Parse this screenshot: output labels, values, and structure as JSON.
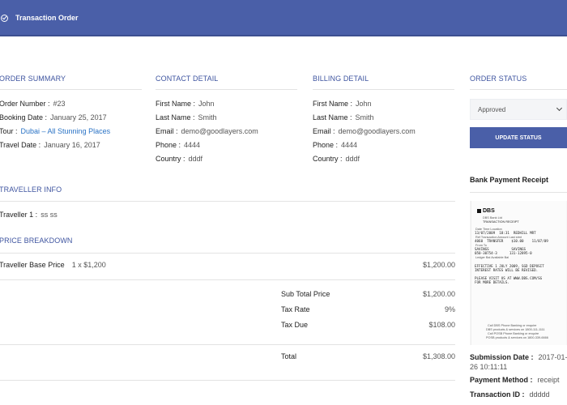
{
  "header": {
    "title": "Transaction Order"
  },
  "order_summary": {
    "title": "ORDER SUMMARY",
    "order_number_label": "Order Number :",
    "order_number": "#23",
    "booking_date_label": "Booking Date :",
    "booking_date": "January 25, 2017",
    "tour_label": "Tour :",
    "tour": "Dubai – All Stunning Places",
    "travel_date_label": "Travel Date :",
    "travel_date": "January 16, 2017"
  },
  "contact": {
    "title": "CONTACT DETAIL",
    "first_name_label": "First Name :",
    "first_name": "John",
    "last_name_label": "Last Name :",
    "last_name": "Smith",
    "email_label": "Email :",
    "email": "demo@goodlayers.com",
    "phone_label": "Phone :",
    "phone": "4444",
    "country_label": "Country :",
    "country": "dddf"
  },
  "billing": {
    "title": "BILLING DETAIL",
    "first_name_label": "First Name :",
    "first_name": "John",
    "last_name_label": "Last Name :",
    "last_name": "Smith",
    "email_label": "Email :",
    "email": "demo@goodlayers.com",
    "phone_label": "Phone :",
    "phone": "4444",
    "country_label": "Country :",
    "country": "dddf"
  },
  "order_status": {
    "title": "ORDER STATUS",
    "selected": "Approved",
    "button": "UPDATE STATUS"
  },
  "traveller": {
    "title": "TRAVELLER INFO",
    "label": "Traveller 1 :",
    "value": "ss ss"
  },
  "price": {
    "title": "PRICE BREAKDOWN",
    "base_label": "Traveller Base Price",
    "base_qty": "1 x $1,200",
    "base_amount": "$1,200.00",
    "subtotal_label": "Sub Total Price",
    "subtotal": "$1,200.00",
    "tax_rate_label": "Tax Rate",
    "tax_rate": "9%",
    "tax_due_label": "Tax Due",
    "tax_due": "$108.00",
    "total_label": "Total",
    "total": "$1,308.00"
  },
  "receipt": {
    "title": "Bank Payment Receipt",
    "logo": "DBS",
    "bank": "DBS Bank Ltd",
    "doc_title": "TRANSACTION RECEIPT",
    "line1_labels": "Date       Time       Location",
    "line1": "13/07/2009  18:31  REDHILL MRT",
    "line2_labels": "Ref    Transaction   Amount     Last stmt",
    "line2": "4060  TRANSFER    $10.00    11/07/09",
    "line3_labels": "From               To",
    "line3": "SAVINGS           SAVINGS",
    "line4": "050-30754-3      131-12895-0",
    "line5_labels": "Ledger Bal         Available Bal",
    "notice1": "EFFECTIVE 1 JULY 2009, SGD DEPOSIT",
    "notice2": "INTEREST RATES WILL BE REVISED.",
    "notice3": "PLEASE VISIT US AT WWW.DBS.COM/SG",
    "notice4": "FOR MORE DETAILS.",
    "foot1": "Call DBS Phone Banking or enquire",
    "foot2": "DBS products & services on 1800-111-1111",
    "foot3": "Call POSB Phone Banking or enquire",
    "foot4": "POSB products & services on 1800-339-6666",
    "submission_label": "Submission Date :",
    "submission": "2017-01-",
    "submission2": "26 10:11:11",
    "method_label": "Payment Method :",
    "method": "receipt",
    "txn_label": "Transaction ID :",
    "txn": "ddddd"
  }
}
